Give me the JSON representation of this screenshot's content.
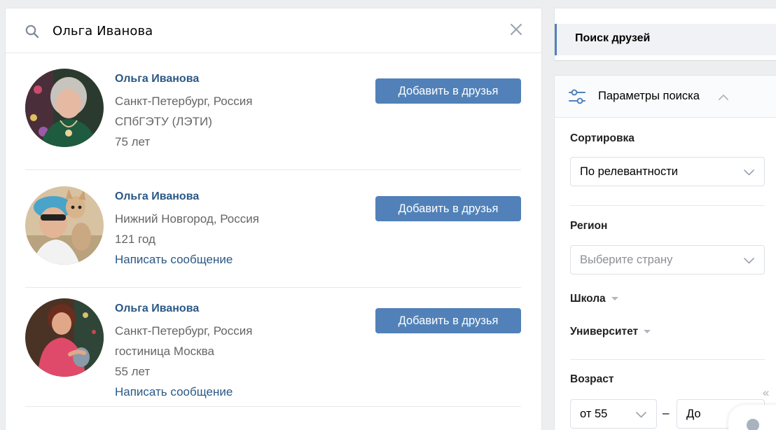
{
  "search": {
    "query": "Ольга Иванова"
  },
  "results": [
    {
      "name": "Ольга Иванова",
      "lines": [
        "Санкт-Петербург, Россия",
        "СПбГЭТУ (ЛЭТИ)",
        "75 лет"
      ],
      "message_link": "",
      "button": "Добавить в друзья"
    },
    {
      "name": "Ольга Иванова",
      "lines": [
        "Нижний Новгород, Россия",
        "121 год"
      ],
      "message_link": "Написать сообщение",
      "button": "Добавить в друзья"
    },
    {
      "name": "Ольга Иванова",
      "lines": [
        "Санкт-Петербург, Россия",
        "гостиница Москва",
        "55 лет"
      ],
      "message_link": "Написать сообщение",
      "button": "Добавить в друзья"
    }
  ],
  "side_menu": {
    "active_item": "Поиск друзей"
  },
  "filters": {
    "title": "Параметры поиска",
    "sort": {
      "label": "Сортировка",
      "value": "По релевантности"
    },
    "region": {
      "label": "Регион",
      "placeholder": "Выберите страну"
    },
    "school": {
      "label": "Школа"
    },
    "university": {
      "label": "Университет"
    },
    "age": {
      "label": "Возраст",
      "from": "от 55",
      "dash": "–",
      "to": "До"
    },
    "collapse_arrows": "«"
  },
  "colors": {
    "accent": "#5181b8",
    "link": "#2a5885",
    "background": "#edeef0"
  }
}
